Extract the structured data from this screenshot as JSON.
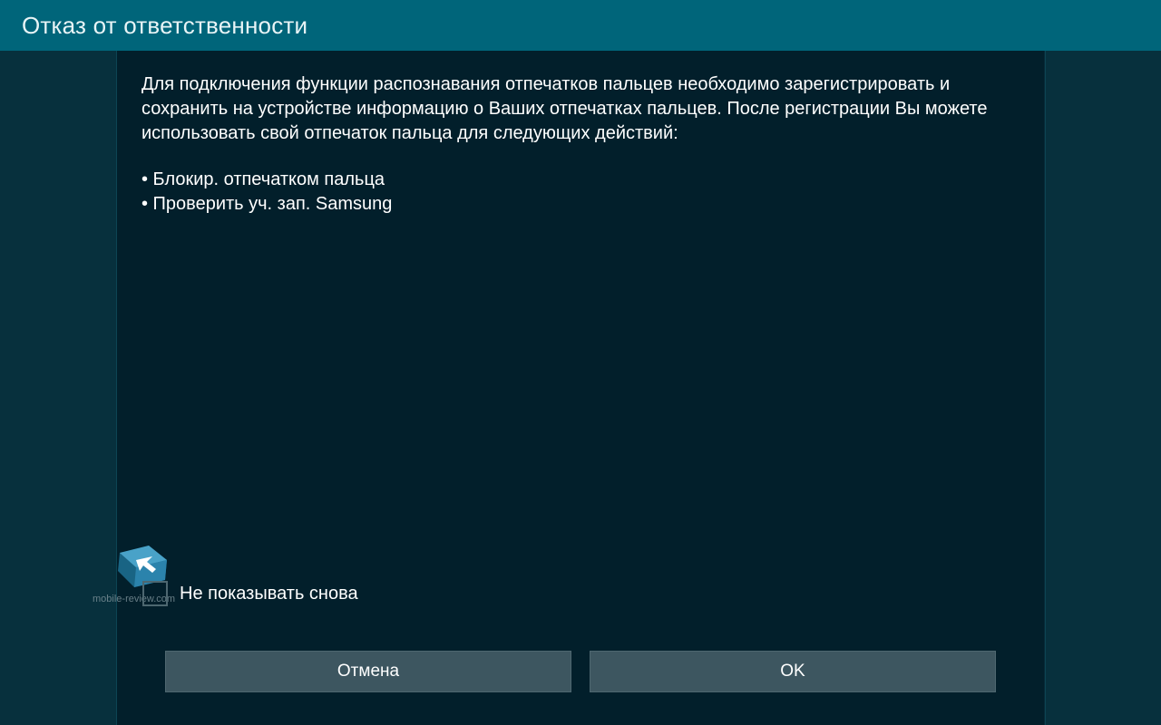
{
  "dialog": {
    "title": "Отказ от ответственности",
    "body_paragraph": "Для подключения функции распознавания отпечатков пальцев необходимо зарегистрировать и сохранить на устройстве информацию о Ваших отпечатках пальцев. После регистрации Вы можете использовать свой отпечаток пальца для следующих действий:",
    "bullets": [
      "• Блокир. отпечатком пальца",
      "• Проверить уч. зап. Samsung"
    ],
    "checkbox_label": "Не показывать снова",
    "checkbox_checked": false,
    "cancel_label": "Отмена",
    "ok_label": "OK"
  },
  "watermark": {
    "text": "mobile-review.com"
  },
  "colors": {
    "title_bar": "#00657a",
    "background": "#062a37",
    "panel": "#021f2b",
    "button": "#3d5660"
  }
}
